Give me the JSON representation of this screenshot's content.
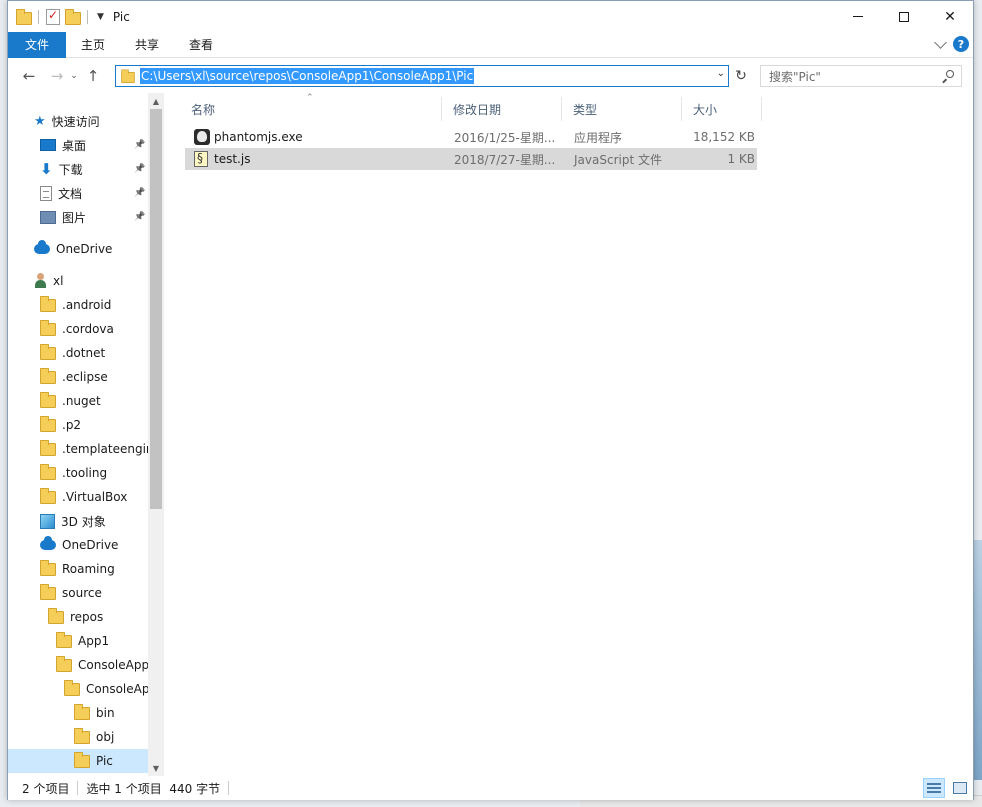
{
  "window": {
    "title": "Pic",
    "controls": {
      "minimize": "—",
      "maximize": "☐",
      "close": "✕"
    }
  },
  "ribbon": {
    "tabs": [
      "文件",
      "主页",
      "共享",
      "查看"
    ],
    "help": "?"
  },
  "address": {
    "path": "C:\\Users\\xl\\source\\repos\\ConsoleApp1\\ConsoleApp1\\Pic",
    "search_placeholder": "搜索\"Pic\""
  },
  "nav": {
    "items": [
      {
        "label": "快速访问",
        "icon": "star-icon",
        "indent": 1,
        "pinned": false
      },
      {
        "label": "桌面",
        "icon": "desktop-icon",
        "indent": 2,
        "pinned": true
      },
      {
        "label": "下载",
        "icon": "download-icon",
        "indent": 2,
        "pinned": true
      },
      {
        "label": "文档",
        "icon": "documents-icon",
        "indent": 2,
        "pinned": true
      },
      {
        "label": "图片",
        "icon": "pictures-icon",
        "indent": 2,
        "pinned": true
      },
      {
        "label": "OneDrive",
        "icon": "onedrive-icon",
        "indent": 1,
        "pinned": false
      },
      {
        "label": "xl",
        "icon": "user-icon",
        "indent": 1,
        "pinned": false
      },
      {
        "label": ".android",
        "icon": "folder-icon",
        "indent": 2,
        "pinned": false
      },
      {
        "label": ".cordova",
        "icon": "folder-icon",
        "indent": 2,
        "pinned": false
      },
      {
        "label": ".dotnet",
        "icon": "folder-icon",
        "indent": 2,
        "pinned": false
      },
      {
        "label": ".eclipse",
        "icon": "folder-icon",
        "indent": 2,
        "pinned": false
      },
      {
        "label": ".nuget",
        "icon": "folder-icon",
        "indent": 2,
        "pinned": false
      },
      {
        "label": ".p2",
        "icon": "folder-icon",
        "indent": 2,
        "pinned": false
      },
      {
        "label": ".templateengin",
        "icon": "folder-icon",
        "indent": 2,
        "pinned": false
      },
      {
        "label": ".tooling",
        "icon": "folder-icon",
        "indent": 2,
        "pinned": false
      },
      {
        "label": ".VirtualBox",
        "icon": "folder-icon",
        "indent": 2,
        "pinned": false
      },
      {
        "label": "3D 对象",
        "icon": "3d-objects-icon",
        "indent": 2,
        "pinned": false
      },
      {
        "label": "OneDrive",
        "icon": "onedrive-icon",
        "indent": 2,
        "pinned": false
      },
      {
        "label": "Roaming",
        "icon": "folder-icon",
        "indent": 2,
        "pinned": false
      },
      {
        "label": "source",
        "icon": "folder-icon",
        "indent": 2,
        "pinned": false
      },
      {
        "label": "repos",
        "icon": "folder-icon",
        "indent": 3,
        "pinned": false
      },
      {
        "label": "App1",
        "icon": "folder-icon",
        "indent": 4,
        "pinned": false
      },
      {
        "label": "ConsoleApp",
        "icon": "folder-icon",
        "indent": 4,
        "pinned": false
      },
      {
        "label": "ConsoleAp",
        "icon": "folder-icon",
        "indent": 5,
        "pinned": false
      },
      {
        "label": "bin",
        "icon": "folder-icon",
        "indent": 6,
        "pinned": false
      },
      {
        "label": "obj",
        "icon": "folder-icon",
        "indent": 6,
        "pinned": false
      },
      {
        "label": "Pic",
        "icon": "folder-icon",
        "indent": 6,
        "pinned": false,
        "selected": true
      }
    ]
  },
  "columns": [
    "名称",
    "修改日期",
    "类型",
    "大小"
  ],
  "files": [
    {
      "name": "phantomjs.exe",
      "date": "2016/1/25-星期...",
      "type": "应用程序",
      "size": "18,152 KB",
      "icon": "exe-icon",
      "selected": false
    },
    {
      "name": "test.js",
      "date": "2018/7/27-星期...",
      "type": "JavaScript 文件",
      "size": "1 KB",
      "icon": "js-file-icon",
      "selected": true
    }
  ],
  "status": {
    "count": "2 个项目",
    "selection": "选中 1 个项目  440 字节"
  },
  "colors": {
    "accent": "#1979ca",
    "selection": "#cce8ff",
    "address_highlight": "#3399ff"
  }
}
